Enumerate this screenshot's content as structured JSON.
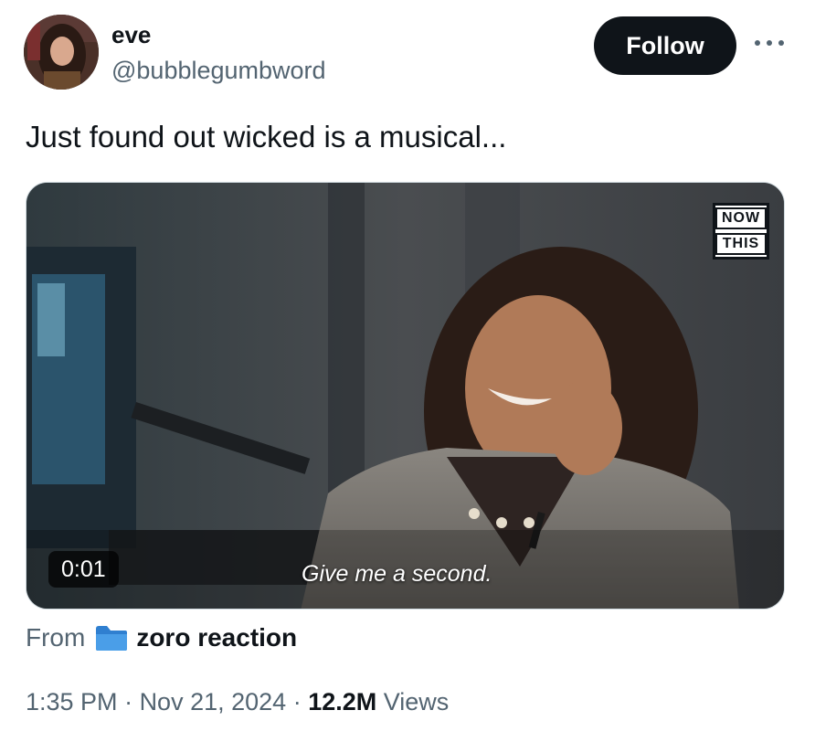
{
  "author": {
    "name": "eve",
    "handle": "@bubblegumbword"
  },
  "header": {
    "follow_label": "Follow"
  },
  "tweet": {
    "text": "Just found out wicked is a musical..."
  },
  "media": {
    "timestamp": "0:01",
    "caption": "Give me a second.",
    "logo_top": "NOW",
    "logo_bottom": "THIS"
  },
  "source": {
    "from_label": "From",
    "name": "zoro reaction",
    "icon": "folder-icon",
    "icon_color": "#4a9ee8"
  },
  "meta": {
    "time": "1:35 PM",
    "separator": " · ",
    "date": "Nov 21, 2024",
    "views_count": "12.2M",
    "views_label": "Views"
  },
  "colors": {
    "primary_text": "#0f1419",
    "secondary_text": "#536471",
    "follow_bg": "#0f1419"
  }
}
